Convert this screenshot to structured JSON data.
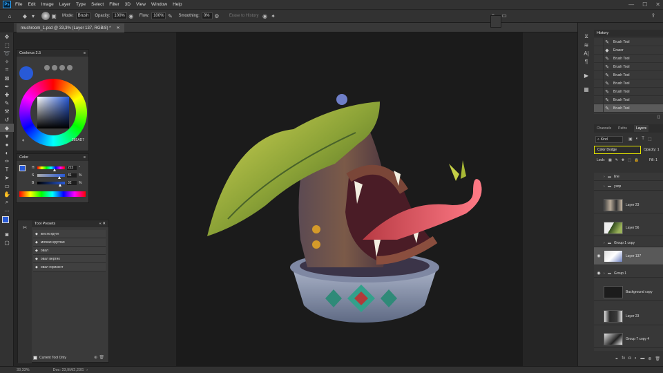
{
  "menu": [
    "File",
    "Edit",
    "Image",
    "Layer",
    "Type",
    "Select",
    "Filter",
    "3D",
    "View",
    "Window",
    "Help"
  ],
  "options": {
    "mode_label": "Mode:",
    "mode_value": "Brush",
    "opacity_label": "Opacity:",
    "opacity_value": "100%",
    "flow_label": "Flow:",
    "flow_value": "100%",
    "smoothing_label": "Smoothing:",
    "smoothing_value": "0%",
    "erase_history": "Erase to History"
  },
  "doc_tab": "mushroom_1.psd @ 33,3% (Layer 137, RGB/8) *",
  "coolorus": {
    "title": "Coolorus 2.5",
    "hex": "285AD7"
  },
  "color_panel": {
    "title": "Color",
    "rows": [
      {
        "label": "H",
        "value": "222",
        "unit": "°",
        "fraction": 0.62
      },
      {
        "label": "S",
        "value": "81",
        "unit": "%",
        "fraction": 0.81
      },
      {
        "label": "B",
        "value": "82",
        "unit": "%",
        "fraction": 0.82
      }
    ],
    "accent": "#285ad7"
  },
  "tool_presets": {
    "title": "Tool Presets",
    "items": [
      "жестк кругл",
      "мягкая круглая",
      "овал",
      "овал вертик",
      "овал горизонт"
    ],
    "current_only": "Current Tool Only"
  },
  "history": {
    "title": "History",
    "items": [
      "Brush Tool",
      "Eraser",
      "Brush Tool",
      "Brush Tool",
      "Brush Tool",
      "Brush Tool",
      "Brush Tool",
      "Brush Tool",
      "Brush Tool"
    ]
  },
  "layers_panel": {
    "tabs": [
      "Channels",
      "Paths",
      "Layers"
    ],
    "kind": "Kind",
    "blend_mode": "Color Dodge",
    "opacity_label": "Opacity:",
    "opacity_value": "1",
    "lock_label": "Lock:",
    "fill_label": "Fill:",
    "fill_value": "1",
    "layers": [
      {
        "name": "line",
        "group": true
      },
      {
        "name": "узор",
        "group": true
      },
      {
        "name": "Layer 23"
      },
      {
        "name": "Layer 56"
      },
      {
        "name": "Group 1 copy",
        "group": true
      },
      {
        "name": "Layer 137",
        "selected": true
      },
      {
        "name": "Group 1",
        "group": true
      },
      {
        "name": "Background copy"
      },
      {
        "name": "Layer 23"
      },
      {
        "name": "Group 7 copy 4"
      }
    ]
  },
  "status": {
    "zoom": "33,33%",
    "doc": "Doc: 23,9M/2,23G"
  }
}
